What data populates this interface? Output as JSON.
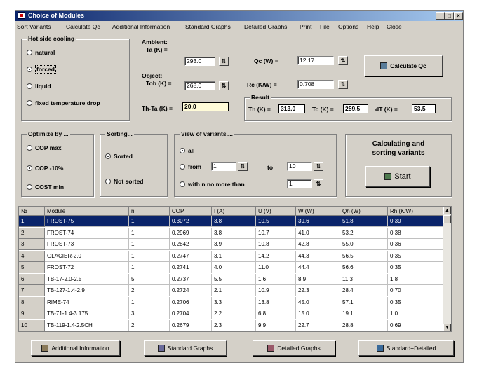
{
  "window": {
    "title": "Choice of Modules"
  },
  "menu": [
    "Sort Variants",
    "Calculate Qc",
    "Additional Information",
    "Standard Graphs",
    "Detailed Graphs",
    "Print",
    "File",
    "Options",
    "Help",
    "Close"
  ],
  "hot_side": {
    "title": "Hot side cooling",
    "options": [
      "natural",
      "forced",
      "liquid",
      "fixed temperature drop"
    ],
    "selected": 1
  },
  "ambient": {
    "label": "Ambient:",
    "ta_label": "Ta (K) =",
    "ta_value": "293.0",
    "object_label": "Object:",
    "tob_label": "Tob (K) =",
    "tob_value": "268.0",
    "thta_label": "Th-Ta (K) =",
    "thta_value": "20.0"
  },
  "qc": {
    "label": "Qc (W) =",
    "value": "12.17"
  },
  "rc": {
    "label": "Rc (K/W) =",
    "value": "0.708"
  },
  "calc_button": "Calculate Qc",
  "result": {
    "title": "Result",
    "th_label": "Th (K) =",
    "th_value": "313.0",
    "tc_label": "Tc (K) =",
    "tc_value": "259.5",
    "dt_label": "dT (K) =",
    "dt_value": "53.5"
  },
  "optimize": {
    "title": "Optimize by ...",
    "options": [
      "COP max",
      "COP -10%",
      "COST min"
    ],
    "selected": 1
  },
  "sorting": {
    "title": "Sorting...",
    "options": [
      "Sorted",
      "Not sorted"
    ],
    "selected": 0
  },
  "view": {
    "title": "View of variants....",
    "all": "all",
    "from": "from",
    "from_value": "1",
    "to": "to",
    "to_value": "10",
    "with_n": "with n no more than",
    "n_value": "1",
    "selected": 0
  },
  "calc_sort": {
    "text1": "Calculating and",
    "text2": "sorting variants",
    "start": "Start"
  },
  "table": {
    "headers": [
      "№",
      "Module",
      "n",
      "COP",
      "I (A)",
      "U (V)",
      "W (W)",
      "Qh (W)",
      "Rh (K/W)"
    ],
    "rows": [
      [
        "1",
        "FROST-75",
        "1",
        "0.3072",
        "3.8",
        "10.5",
        "39.6",
        "51.8",
        "0.39"
      ],
      [
        "2",
        "FROST-74",
        "1",
        "0.2969",
        "3.8",
        "10.7",
        "41.0",
        "53.2",
        "0.38"
      ],
      [
        "3",
        "FROST-73",
        "1",
        "0.2842",
        "3.9",
        "10.8",
        "42.8",
        "55.0",
        "0.36"
      ],
      [
        "4",
        "GLACIER-2.0",
        "1",
        "0.2747",
        "3.1",
        "14.2",
        "44.3",
        "56.5",
        "0.35"
      ],
      [
        "5",
        "FROST-72",
        "1",
        "0.2741",
        "4.0",
        "11.0",
        "44.4",
        "56.6",
        "0.35"
      ],
      [
        "6",
        "TB-17-2.0-2.5",
        "5",
        "0.2737",
        "5.5",
        "1.6",
        "8.9",
        "11.3",
        "1.8"
      ],
      [
        "7",
        "TB-127-1.4-2.9",
        "2",
        "0.2724",
        "2.1",
        "10.9",
        "22.3",
        "28.4",
        "0.70"
      ],
      [
        "8",
        "RIME-74",
        "1",
        "0.2706",
        "3.3",
        "13.8",
        "45.0",
        "57.1",
        "0.35"
      ],
      [
        "9",
        "TB-71-1.4-3.175",
        "3",
        "0.2704",
        "2.2",
        "6.8",
        "15.0",
        "19.1",
        "1.0"
      ],
      [
        "10",
        "TB-119-1.4-2.5CH",
        "2",
        "0.2679",
        "2.3",
        "9.9",
        "22.7",
        "28.8",
        "0.69"
      ]
    ],
    "selected_row": 0
  },
  "bottom_buttons": [
    "Additional Information",
    "Standard Graphs",
    "Detailed Graphs",
    "Standard+Detailed"
  ]
}
